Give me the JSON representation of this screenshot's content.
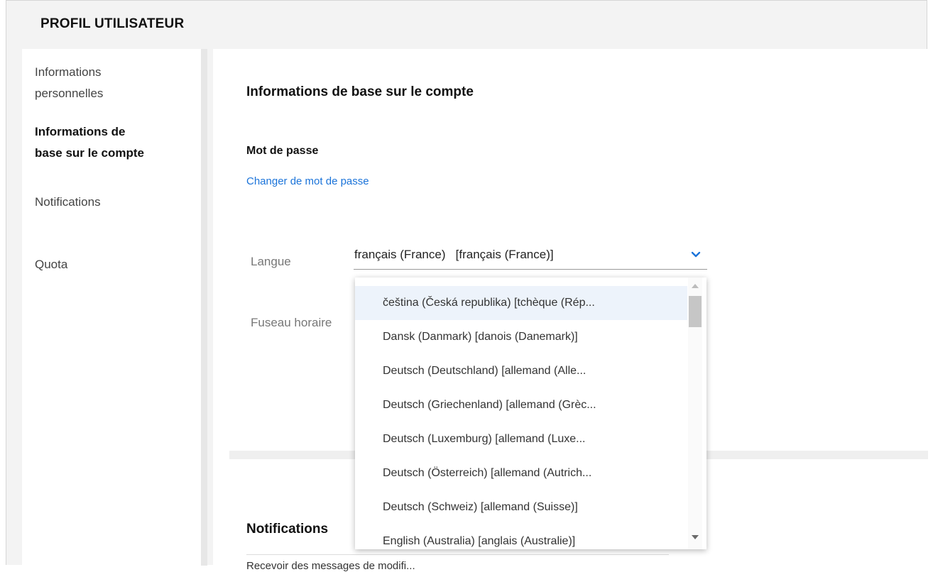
{
  "header": {
    "title": "PROFIL UTILISATEUR"
  },
  "sidebar": {
    "items": [
      {
        "label_line1": "Informations",
        "label_line2": "personnelles",
        "active": false
      },
      {
        "label_line1": "Informations de",
        "label_line2": "base sur le compte",
        "active": true
      },
      {
        "label_line1": "Notifications",
        "active": false
      },
      {
        "label_line1": "Quota",
        "active": false
      }
    ]
  },
  "main": {
    "section_title": "Informations de base sur le compte",
    "password": {
      "label": "Mot de passe",
      "change_link": "Changer de mot de passe"
    },
    "language": {
      "label": "Langue",
      "value": "français (France)   [français (France)]"
    },
    "timezone": {
      "label": "Fuseau horaire"
    },
    "notifications": {
      "title": "Notifications",
      "description": "Recevoir des messages de modifi..."
    }
  },
  "dropdown": {
    "options": [
      "čeština (Česká republika) [tchèque (Rép...",
      "Dansk (Danmark) [danois (Danemark)]",
      "Deutsch (Deutschland) [allemand (Alle...",
      "Deutsch (Griechenland) [allemand (Grèc...",
      "Deutsch (Luxemburg) [allemand (Luxe...",
      "Deutsch (Österreich) [allemand (Autrich...",
      "Deutsch (Schweiz) [allemand (Suisse)]",
      "English (Australia) [anglais (Australie)]"
    ],
    "highlighted_index": 0
  },
  "colors": {
    "link": "#1a73d9",
    "highlight": "#edf3fb",
    "chevron": "#1a73d9"
  }
}
